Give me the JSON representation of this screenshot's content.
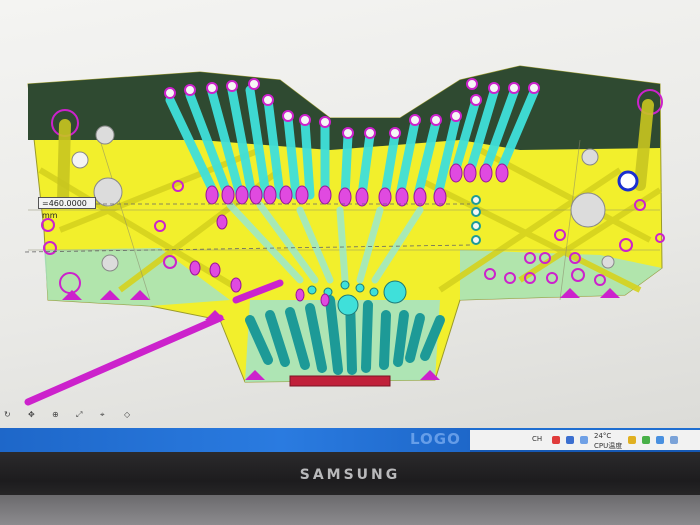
{
  "viewport": {
    "dimension_label": "=460.0000 mm",
    "colors": {
      "background": "#e9e9e6",
      "part_dark": "#2f4a31",
      "part_yellow": "#f2ef2c",
      "part_mint": "#a6e3c3",
      "cooling_cyan": "#3fe0da",
      "cooling_teal": "#1d9a97",
      "ejector_magenta": "#cc22cc",
      "highlight_blue": "#1a2fd0",
      "gate_red": "#c0203a"
    }
  },
  "taskbar": {
    "brand_text": "LOGO",
    "tray_lang": "CH",
    "tray_temp": "24°C",
    "tray_cpu": "CPU温度",
    "tray_icons": [
      "shield-icon",
      "network-icon",
      "volume-icon",
      "battery-icon",
      "keyboard-icon"
    ]
  },
  "monitor": {
    "brand": "SAMSUNG"
  }
}
